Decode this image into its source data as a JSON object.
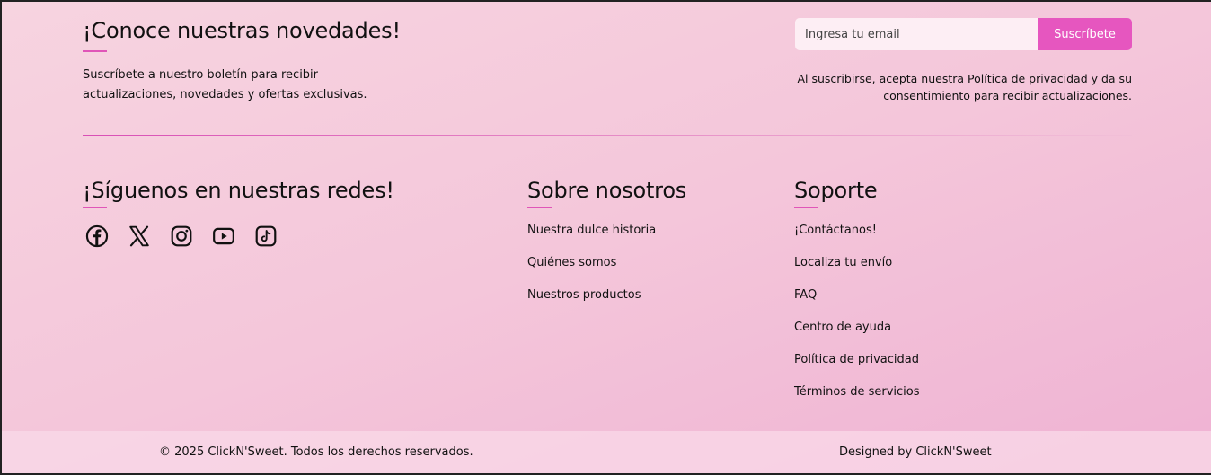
{
  "newsletter": {
    "title": "¡Conoce nuestras novedades!",
    "description": "Suscríbete a nuestro boletín para recibir actualizaciones, novedades y ofertas exclusivas.",
    "email_placeholder": "Ingresa tu email",
    "email_value": "",
    "subscribe_label": "Suscríbete",
    "consent": "Al suscribirse, acepta nuestra Política de privacidad y da su consentimiento para recibir actualizaciones."
  },
  "social": {
    "title": "¡Síguenos en nuestras redes!",
    "icons": [
      "facebook-icon",
      "x-icon",
      "instagram-icon",
      "youtube-icon",
      "tiktok-icon"
    ]
  },
  "about": {
    "title": "Sobre nosotros",
    "links": [
      "Nuestra dulce historia",
      "Quiénes somos",
      "Nuestros productos"
    ]
  },
  "support": {
    "title": "Soporte",
    "links": [
      "¡Contáctanos!",
      "Localiza tu envío",
      "FAQ",
      "Centro de ayuda",
      "Política de privacidad",
      "Términos de servicios"
    ]
  },
  "footer": {
    "copyright": "© 2025 ClickN'Sweet. Todos los derechos reservados.",
    "designed_by": "Designed by ClickN'Sweet"
  },
  "colors": {
    "accent": "#e656bf",
    "background_start": "#f7d4e0",
    "background_end": "#efb2d3",
    "text": "#111111"
  }
}
